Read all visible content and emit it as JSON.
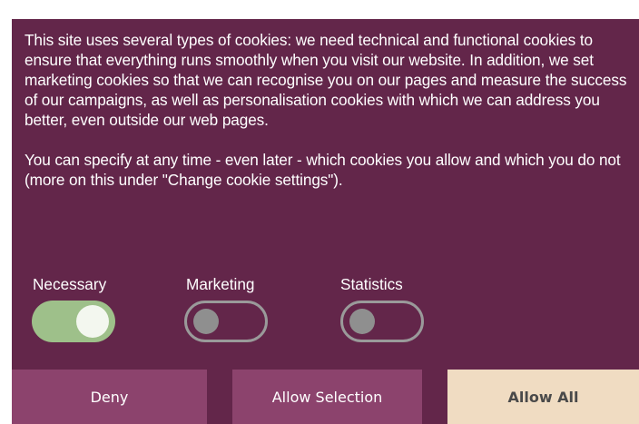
{
  "banner": {
    "paragraphs": [
      "This site uses several types of cookies: we need technical and functional cookies to ensure that everything runs smoothly when you visit our website. In addition, we set marketing cookies so that we can recognise you on our pages and measure the success of our campaigns, as well as personalisation cookies with which we can address you better, even outside our web pages.",
      "You can specify at any time - even later - which cookies you allow and which you do not (more on this under \"Change cookie settings\")."
    ],
    "toggles": [
      {
        "label": "Necessary",
        "state": "on"
      },
      {
        "label": "Marketing",
        "state": "off"
      },
      {
        "label": "Statistics",
        "state": "off"
      }
    ],
    "buttons": {
      "deny": "Deny",
      "allow_selection": "Allow Selection",
      "allow_all": "Allow All"
    }
  },
  "colors": {
    "background": "#63264a",
    "button": "#8c436d",
    "accent_button": "#f0dcc2",
    "toggle_on": "#9ec08a",
    "toggle_off_border": "#9a9a9a"
  }
}
